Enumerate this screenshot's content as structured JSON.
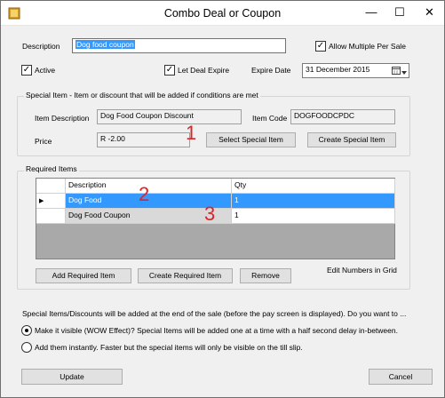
{
  "window": {
    "title": "Combo Deal or Coupon",
    "minimize": "—",
    "maximize": "☐",
    "close": "✕"
  },
  "form": {
    "description_label": "Description",
    "description_value": "Dog food coupon",
    "allow_multiple_label": "Allow Multiple Per Sale",
    "allow_multiple_checked": true,
    "active_label": "Active",
    "active_checked": true,
    "let_expire_label": "Let Deal Expire",
    "let_expire_checked": true,
    "expire_date_label": "Expire Date",
    "expire_date_value": "31 December 2015"
  },
  "special_item": {
    "group_title": "Special Item - Item or discount that will be added if conditions are met",
    "item_description_label": "Item Description",
    "item_description_value": "Dog Food Coupon Discount",
    "item_code_label": "Item Code",
    "item_code_value": "DOGFOODCPDC",
    "price_label": "Price",
    "price_value": "R -2.00",
    "select_button": "Select Special Item",
    "create_button": "Create Special Item"
  },
  "required_items": {
    "group_title": "Required Items",
    "columns": [
      "Description",
      "Qty"
    ],
    "rows": [
      {
        "description": "Dog Food",
        "qty": "1",
        "selected": true
      },
      {
        "description": "Dog Food Coupon",
        "qty": "1",
        "selected": false
      }
    ],
    "current_row_marker": "▶",
    "add_button": "Add Required Item",
    "create_button": "Create Required Item",
    "remove_button": "Remove",
    "edit_hint": "Edit Numbers in Grid"
  },
  "annotations": {
    "n1": "1",
    "n2": "2",
    "n3": "3",
    "color": "#d9262b"
  },
  "notice": "Special Items/Discounts will be added at the end of the sale (before the pay screen is displayed). Do you want to ...",
  "options": {
    "wow_label": "Make it visible (WOW Effect)? Special Items will be added one at a time with a half second delay in-between.",
    "wow_checked": true,
    "instant_label": "Add them instantly. Faster but the special items will only be visible on the till slip.",
    "instant_checked": false
  },
  "footer": {
    "update_button": "Update",
    "cancel_button": "Cancel"
  }
}
